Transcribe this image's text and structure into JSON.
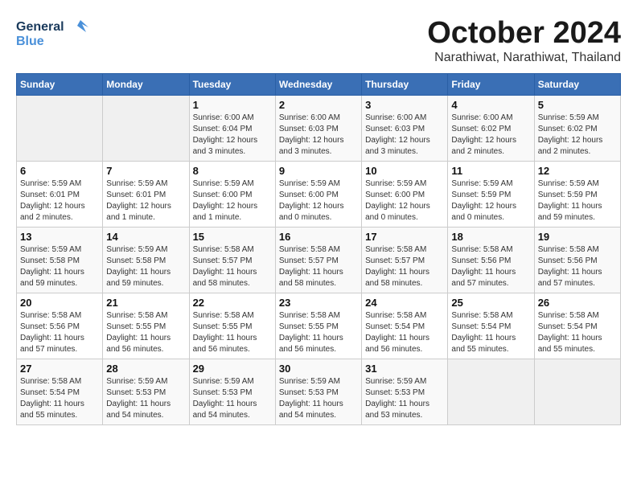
{
  "header": {
    "logo": {
      "general": "General",
      "blue": "Blue"
    },
    "month": "October 2024",
    "location": "Narathiwat, Narathiwat, Thailand"
  },
  "weekdays": [
    "Sunday",
    "Monday",
    "Tuesday",
    "Wednesday",
    "Thursday",
    "Friday",
    "Saturday"
  ],
  "weeks": [
    [
      {
        "day": "",
        "sunrise": "",
        "sunset": "",
        "daylight": ""
      },
      {
        "day": "",
        "sunrise": "",
        "sunset": "",
        "daylight": ""
      },
      {
        "day": "1",
        "sunrise": "Sunrise: 6:00 AM",
        "sunset": "Sunset: 6:04 PM",
        "daylight": "Daylight: 12 hours and 3 minutes."
      },
      {
        "day": "2",
        "sunrise": "Sunrise: 6:00 AM",
        "sunset": "Sunset: 6:03 PM",
        "daylight": "Daylight: 12 hours and 3 minutes."
      },
      {
        "day": "3",
        "sunrise": "Sunrise: 6:00 AM",
        "sunset": "Sunset: 6:03 PM",
        "daylight": "Daylight: 12 hours and 3 minutes."
      },
      {
        "day": "4",
        "sunrise": "Sunrise: 6:00 AM",
        "sunset": "Sunset: 6:02 PM",
        "daylight": "Daylight: 12 hours and 2 minutes."
      },
      {
        "day": "5",
        "sunrise": "Sunrise: 5:59 AM",
        "sunset": "Sunset: 6:02 PM",
        "daylight": "Daylight: 12 hours and 2 minutes."
      }
    ],
    [
      {
        "day": "6",
        "sunrise": "Sunrise: 5:59 AM",
        "sunset": "Sunset: 6:01 PM",
        "daylight": "Daylight: 12 hours and 2 minutes."
      },
      {
        "day": "7",
        "sunrise": "Sunrise: 5:59 AM",
        "sunset": "Sunset: 6:01 PM",
        "daylight": "Daylight: 12 hours and 1 minute."
      },
      {
        "day": "8",
        "sunrise": "Sunrise: 5:59 AM",
        "sunset": "Sunset: 6:00 PM",
        "daylight": "Daylight: 12 hours and 1 minute."
      },
      {
        "day": "9",
        "sunrise": "Sunrise: 5:59 AM",
        "sunset": "Sunset: 6:00 PM",
        "daylight": "Daylight: 12 hours and 0 minutes."
      },
      {
        "day": "10",
        "sunrise": "Sunrise: 5:59 AM",
        "sunset": "Sunset: 6:00 PM",
        "daylight": "Daylight: 12 hours and 0 minutes."
      },
      {
        "day": "11",
        "sunrise": "Sunrise: 5:59 AM",
        "sunset": "Sunset: 5:59 PM",
        "daylight": "Daylight: 12 hours and 0 minutes."
      },
      {
        "day": "12",
        "sunrise": "Sunrise: 5:59 AM",
        "sunset": "Sunset: 5:59 PM",
        "daylight": "Daylight: 11 hours and 59 minutes."
      }
    ],
    [
      {
        "day": "13",
        "sunrise": "Sunrise: 5:59 AM",
        "sunset": "Sunset: 5:58 PM",
        "daylight": "Daylight: 11 hours and 59 minutes."
      },
      {
        "day": "14",
        "sunrise": "Sunrise: 5:59 AM",
        "sunset": "Sunset: 5:58 PM",
        "daylight": "Daylight: 11 hours and 59 minutes."
      },
      {
        "day": "15",
        "sunrise": "Sunrise: 5:58 AM",
        "sunset": "Sunset: 5:57 PM",
        "daylight": "Daylight: 11 hours and 58 minutes."
      },
      {
        "day": "16",
        "sunrise": "Sunrise: 5:58 AM",
        "sunset": "Sunset: 5:57 PM",
        "daylight": "Daylight: 11 hours and 58 minutes."
      },
      {
        "day": "17",
        "sunrise": "Sunrise: 5:58 AM",
        "sunset": "Sunset: 5:57 PM",
        "daylight": "Daylight: 11 hours and 58 minutes."
      },
      {
        "day": "18",
        "sunrise": "Sunrise: 5:58 AM",
        "sunset": "Sunset: 5:56 PM",
        "daylight": "Daylight: 11 hours and 57 minutes."
      },
      {
        "day": "19",
        "sunrise": "Sunrise: 5:58 AM",
        "sunset": "Sunset: 5:56 PM",
        "daylight": "Daylight: 11 hours and 57 minutes."
      }
    ],
    [
      {
        "day": "20",
        "sunrise": "Sunrise: 5:58 AM",
        "sunset": "Sunset: 5:56 PM",
        "daylight": "Daylight: 11 hours and 57 minutes."
      },
      {
        "day": "21",
        "sunrise": "Sunrise: 5:58 AM",
        "sunset": "Sunset: 5:55 PM",
        "daylight": "Daylight: 11 hours and 56 minutes."
      },
      {
        "day": "22",
        "sunrise": "Sunrise: 5:58 AM",
        "sunset": "Sunset: 5:55 PM",
        "daylight": "Daylight: 11 hours and 56 minutes."
      },
      {
        "day": "23",
        "sunrise": "Sunrise: 5:58 AM",
        "sunset": "Sunset: 5:55 PM",
        "daylight": "Daylight: 11 hours and 56 minutes."
      },
      {
        "day": "24",
        "sunrise": "Sunrise: 5:58 AM",
        "sunset": "Sunset: 5:54 PM",
        "daylight": "Daylight: 11 hours and 56 minutes."
      },
      {
        "day": "25",
        "sunrise": "Sunrise: 5:58 AM",
        "sunset": "Sunset: 5:54 PM",
        "daylight": "Daylight: 11 hours and 55 minutes."
      },
      {
        "day": "26",
        "sunrise": "Sunrise: 5:58 AM",
        "sunset": "Sunset: 5:54 PM",
        "daylight": "Daylight: 11 hours and 55 minutes."
      }
    ],
    [
      {
        "day": "27",
        "sunrise": "Sunrise: 5:58 AM",
        "sunset": "Sunset: 5:54 PM",
        "daylight": "Daylight: 11 hours and 55 minutes."
      },
      {
        "day": "28",
        "sunrise": "Sunrise: 5:59 AM",
        "sunset": "Sunset: 5:53 PM",
        "daylight": "Daylight: 11 hours and 54 minutes."
      },
      {
        "day": "29",
        "sunrise": "Sunrise: 5:59 AM",
        "sunset": "Sunset: 5:53 PM",
        "daylight": "Daylight: 11 hours and 54 minutes."
      },
      {
        "day": "30",
        "sunrise": "Sunrise: 5:59 AM",
        "sunset": "Sunset: 5:53 PM",
        "daylight": "Daylight: 11 hours and 54 minutes."
      },
      {
        "day": "31",
        "sunrise": "Sunrise: 5:59 AM",
        "sunset": "Sunset: 5:53 PM",
        "daylight": "Daylight: 11 hours and 53 minutes."
      },
      {
        "day": "",
        "sunrise": "",
        "sunset": "",
        "daylight": ""
      },
      {
        "day": "",
        "sunrise": "",
        "sunset": "",
        "daylight": ""
      }
    ]
  ]
}
